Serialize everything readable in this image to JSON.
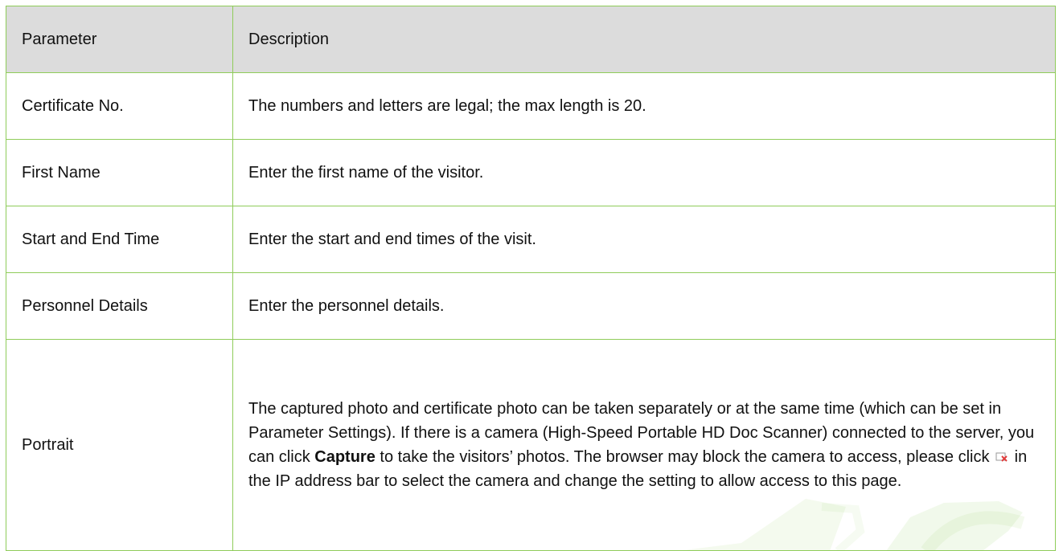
{
  "table": {
    "headers": [
      "Parameter",
      "Description"
    ],
    "rows": [
      {
        "parameter": "Certificate No.",
        "description": "The numbers and letters are legal; the max length is 20."
      },
      {
        "parameter": "First Name",
        "description": "Enter the first name of the visitor."
      },
      {
        "parameter": "Start and End Time",
        "description": "Enter the start and end times of the visit."
      },
      {
        "parameter": "Personnel Details",
        "description": "Enter the personnel details."
      }
    ],
    "portrait": {
      "parameter": "Portrait",
      "description_part1": "The captured photo and certificate photo can be taken separately or at the same time (which can be set in Parameter Settings). If there is a camera (High-Speed Portable HD Doc Scanner) connected to the server, you can click ",
      "bold_word": "Capture",
      "description_part2": " to take the visitors’ photos. The browser may block the camera to access, please click ",
      "icon": "camera-blocked-icon",
      "description_part3": " in the IP address bar to select the camera and change the setting to allow access to this page."
    }
  },
  "colors": {
    "border": "#8fcc5a",
    "header_bg": "#dcdcdc",
    "watermark": "#8fcc5a"
  }
}
